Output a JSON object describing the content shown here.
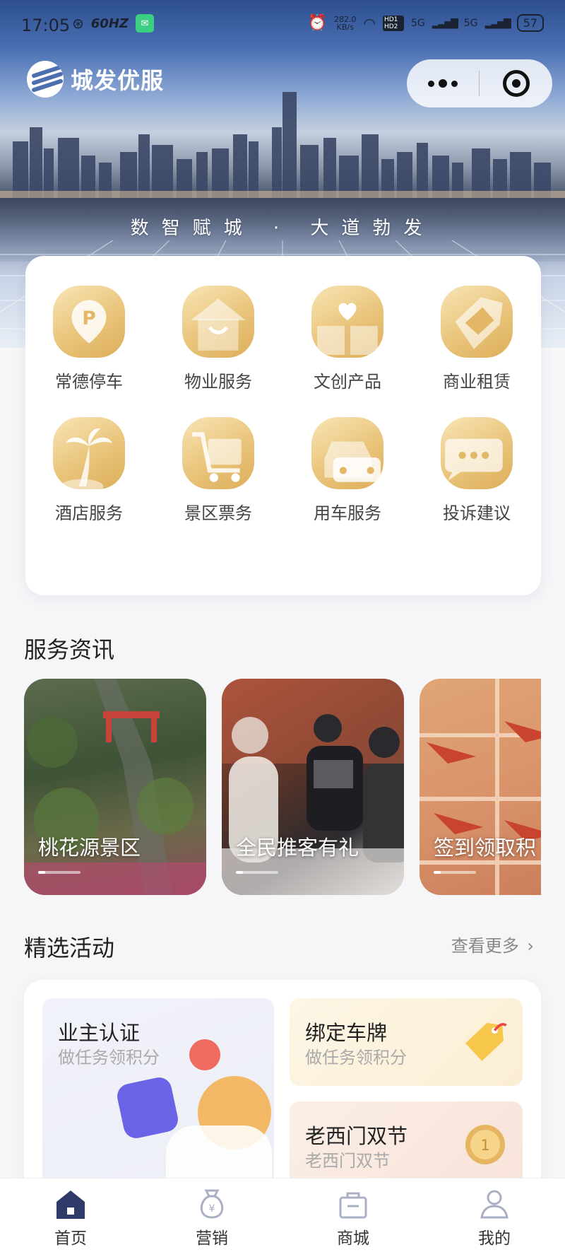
{
  "status_bar": {
    "time": "17:05",
    "refresh": "60HZ",
    "net_speed": "282.0\nKB/s",
    "hd": "HD1 HD2",
    "net1": "5G",
    "net2": "5G",
    "battery": "57"
  },
  "brand": {
    "name": "城发优服"
  },
  "hero": {
    "slogan": "数智赋城 · 大道勃发"
  },
  "services": [
    {
      "label": "常德停车",
      "icon": "parking-icon"
    },
    {
      "label": "物业服务",
      "icon": "house-icon"
    },
    {
      "label": "文创产品",
      "icon": "heart-gift-icon"
    },
    {
      "label": "商业租赁",
      "icon": "tag-icon"
    },
    {
      "label": "酒店服务",
      "icon": "palm-tree-icon"
    },
    {
      "label": "景区票务",
      "icon": "cart-icon"
    },
    {
      "label": "用车服务",
      "icon": "car-icon"
    },
    {
      "label": "投诉建议",
      "icon": "chat-bubble-icon"
    }
  ],
  "news": {
    "title": "服务资讯",
    "items": [
      {
        "label": "桃花源景区"
      },
      {
        "label": "全民推客有礼"
      },
      {
        "label": "签到领取积"
      }
    ]
  },
  "activities": {
    "title": "精选活动",
    "more": "查看更多",
    "items": [
      {
        "title": "业主认证",
        "subtitle": "做任务领积分"
      },
      {
        "title": "绑定车牌",
        "subtitle": "做任务领积分"
      },
      {
        "title": "老西门双节",
        "subtitle": "老西门双节"
      }
    ]
  },
  "tabbar": [
    {
      "label": "首页",
      "icon": "home-icon",
      "active": true
    },
    {
      "label": "营销",
      "icon": "money-bag-icon"
    },
    {
      "label": "商城",
      "icon": "shopping-bag-icon"
    },
    {
      "label": "我的",
      "icon": "user-icon"
    }
  ],
  "colors": {
    "gold_light": "#f8e5b6",
    "gold_dark": "#dcae59",
    "tab_active": "#2f3a68"
  }
}
